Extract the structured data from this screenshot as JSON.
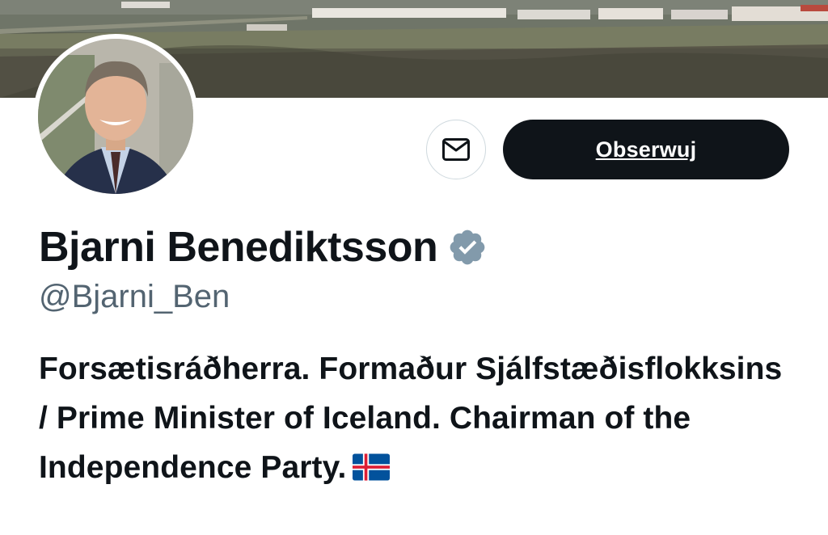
{
  "profile": {
    "display_name": "Bjarni Benediktsson",
    "handle": "@Bjarni_Ben",
    "bio_text": "Forsætisráðherra. Formaður Sjálfstæðisflokksins / Prime Minister of Iceland. Chairman of the Independence Party.",
    "bio_emoji": "iceland-flag",
    "verified": true
  },
  "actions": {
    "follow_label": "Obserwuj",
    "message_icon": "envelope-icon"
  },
  "colors": {
    "follow_bg": "#0f1419",
    "verified_badge": "#829aab",
    "handle": "#536471"
  }
}
